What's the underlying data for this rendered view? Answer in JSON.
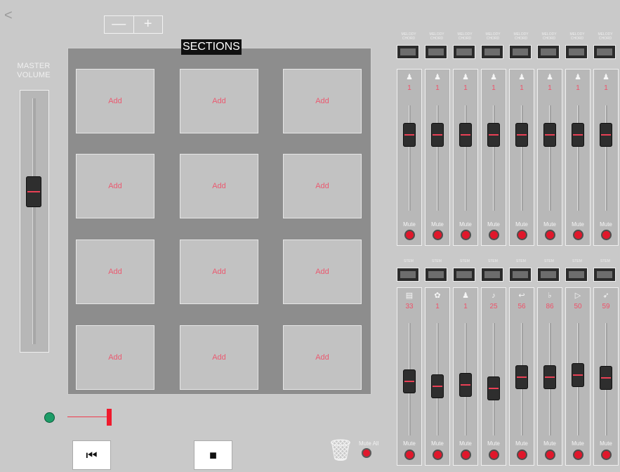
{
  "nav": {
    "back_glyph": "<"
  },
  "zoom": {
    "minus_label": "—",
    "plus_label": "+"
  },
  "master_volume": {
    "label": "MASTER VOLUME",
    "level": 0.62
  },
  "sections": {
    "title": "SECTIONS",
    "pads": [
      "Add",
      "Add",
      "Add",
      "Add",
      "Add",
      "Add",
      "Add",
      "Add",
      "Add",
      "Add",
      "Add",
      "Add"
    ]
  },
  "transport": {
    "rewind_icon": "skip-to-start-icon",
    "stop_icon": "stop-icon",
    "rewind_glyph": "⏮",
    "stop_glyph": "■"
  },
  "mute_all": {
    "label": "Mute All"
  },
  "mixer": {
    "top_label": "MELODY CHORD",
    "bottom_label": "STEM",
    "mute_label": "Mute",
    "top_channels": [
      {
        "icon": "piano-icon",
        "glyph": "♟",
        "number": "1",
        "level": 0.72
      },
      {
        "icon": "piano-icon",
        "glyph": "♟",
        "number": "1",
        "level": 0.72
      },
      {
        "icon": "piano-icon",
        "glyph": "♟",
        "number": "1",
        "level": 0.72
      },
      {
        "icon": "piano-icon",
        "glyph": "♟",
        "number": "1",
        "level": 0.72
      },
      {
        "icon": "piano-icon",
        "glyph": "♟",
        "number": "1",
        "level": 0.72
      },
      {
        "icon": "piano-icon",
        "glyph": "♟",
        "number": "1",
        "level": 0.72
      },
      {
        "icon": "piano-icon",
        "glyph": "♟",
        "number": "1",
        "level": 0.72
      },
      {
        "icon": "piano-icon",
        "glyph": "♟",
        "number": "1",
        "level": 0.72
      }
    ],
    "bottom_channels": [
      {
        "icon": "keyboard-icon",
        "glyph": "▤",
        "number": "33",
        "level": 0.48
      },
      {
        "icon": "drum-icon",
        "glyph": "✿",
        "number": "1",
        "level": 0.44
      },
      {
        "icon": "piano-icon",
        "glyph": "♟",
        "number": "1",
        "level": 0.45
      },
      {
        "icon": "guitar-icon",
        "glyph": "♪",
        "number": "25",
        "level": 0.42
      },
      {
        "icon": "horn-icon",
        "glyph": "↩",
        "number": "56",
        "level": 0.52
      },
      {
        "icon": "bass-icon",
        "glyph": "♭",
        "number": "86",
        "level": 0.52
      },
      {
        "icon": "play-icon",
        "glyph": "▷",
        "number": "50",
        "level": 0.54
      },
      {
        "icon": "feather-icon",
        "glyph": "➶",
        "number": "59",
        "level": 0.51
      }
    ]
  },
  "colors": {
    "accent_red": "#e0172b",
    "label_pink": "#ea5a70",
    "status_green": "#1d9c67"
  }
}
